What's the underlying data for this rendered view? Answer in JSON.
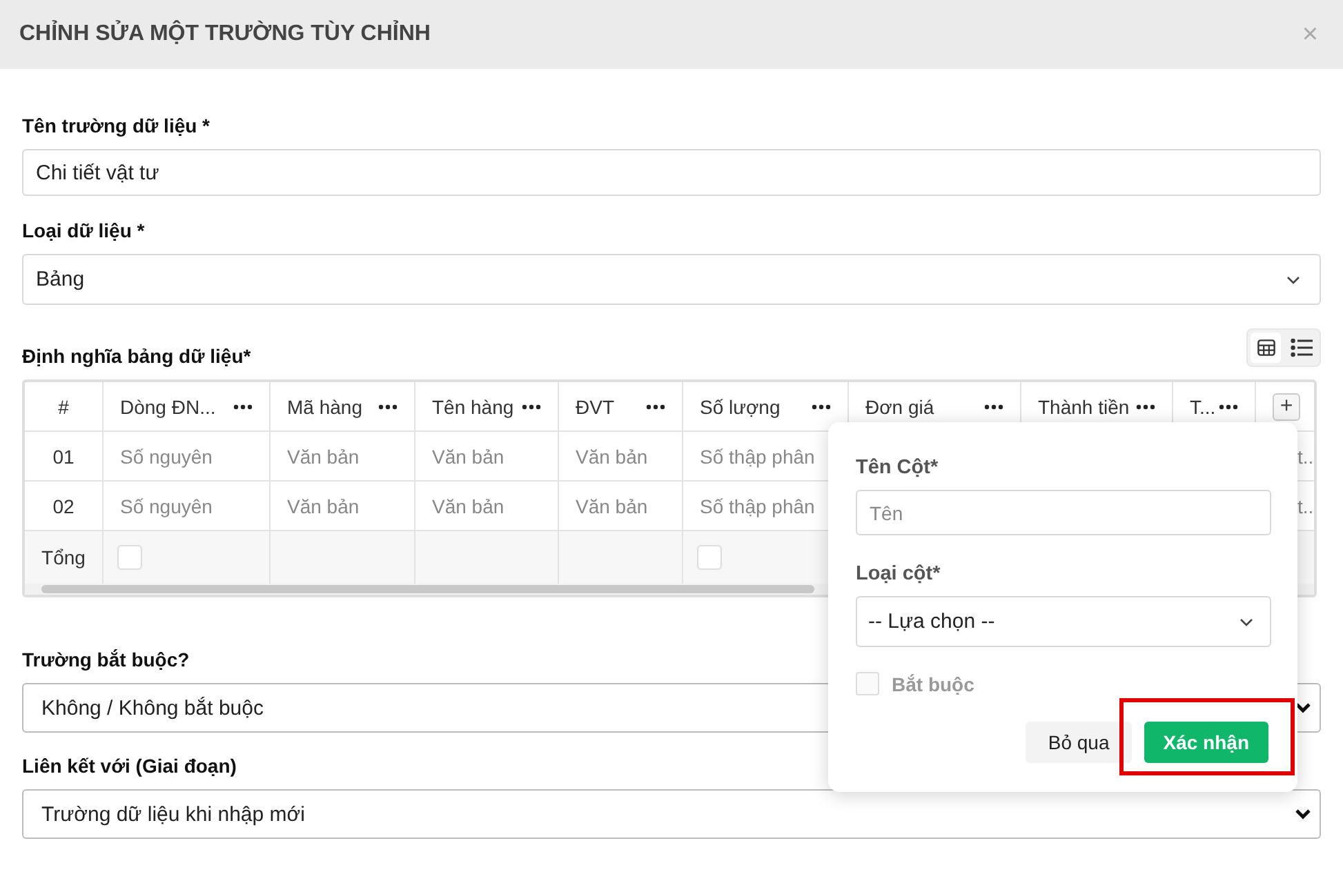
{
  "dialog": {
    "title": "CHỈNH SỬA MỘT TRƯỜNG TÙY CHỈNH",
    "close_icon": "×"
  },
  "fields_top": [
    {
      "label": "Tên trường dữ liệu *",
      "kind": "text",
      "value": "Chi tiết vật tư"
    },
    {
      "label": "Loại dữ liệu *",
      "kind": "select",
      "value": "Bảng"
    }
  ],
  "table_definition": {
    "label": "Định nghĩa bảng dữ liệu*",
    "view_modes": [
      {
        "kind": "grid",
        "selected": true
      },
      {
        "kind": "list",
        "selected": false
      }
    ],
    "columns": [
      {
        "header": "#"
      },
      {
        "header": "Dòng ĐN...",
        "total_checkbox": {
          "checked": false
        }
      },
      {
        "header": "Mã hàng"
      },
      {
        "header": "Tên hàng"
      },
      {
        "header": "ĐVT"
      },
      {
        "header": "Số lượng",
        "total_checkbox": {
          "checked": false
        }
      },
      {
        "header": "Đơn giá"
      },
      {
        "header": "Thành tiền"
      },
      {
        "header": "T..."
      }
    ],
    "add_column_button": "+",
    "rows": [
      {
        "number": "01",
        "values": [
          "Số nguyên",
          "Văn bản",
          "Văn bản",
          "Văn bản",
          "Số thập phân"
        ],
        "overflow": "t..."
      },
      {
        "number": "02",
        "values": [
          "Số nguyên",
          "Văn bản",
          "Văn bản",
          "Văn bản",
          "Số thập phân"
        ],
        "overflow": "t..."
      }
    ],
    "total_label": "Tổng"
  },
  "popover": {
    "fields": [
      {
        "label": "Tên Cột*",
        "kind": "text",
        "placeholder": "Tên"
      },
      {
        "label": "Loại cột*",
        "kind": "select",
        "value": "-- Lựa chọn --"
      }
    ],
    "required_checkbox": {
      "label": "Bắt buộc",
      "checked": false,
      "disabled": true
    },
    "buttons": [
      {
        "label": "Bỏ qua",
        "kind": "secondary"
      },
      {
        "label": "Xác nhận",
        "kind": "primary",
        "highlighted": true
      }
    ]
  },
  "fields_bottom": [
    {
      "label": "Trường bắt buộc?",
      "kind": "native-select",
      "value": "Không / Không bắt buộc"
    },
    {
      "label": "Liên kết với (Giai đoạn)",
      "kind": "native-select",
      "value": "Trường dữ liệu khi nhập mới"
    }
  ]
}
